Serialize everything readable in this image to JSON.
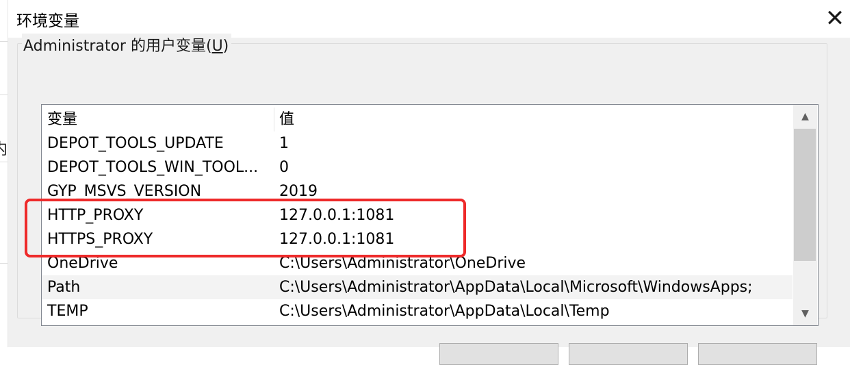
{
  "window": {
    "title": "环境变量",
    "close_glyph": "✕"
  },
  "background_window": {
    "cut_text": "内"
  },
  "user_vars": {
    "group_label_prefix": "Administrator 的用户变量(",
    "group_label_accel": "U",
    "group_label_suffix": ")",
    "columns": [
      "变量",
      "值"
    ],
    "rows": [
      {
        "name": "DEPOT_TOOLS_UPDATE",
        "value": "1"
      },
      {
        "name": "DEPOT_TOOLS_WIN_TOOL...",
        "value": "0"
      },
      {
        "name": "GYP_MSVS_VERSION",
        "value": "2019"
      },
      {
        "name": "HTTP_PROXY",
        "value": "127.0.0.1:1081"
      },
      {
        "name": "HTTPS_PROXY",
        "value": "127.0.0.1:1081"
      },
      {
        "name": "OneDrive",
        "value": "C:\\Users\\Administrator\\OneDrive"
      },
      {
        "name": "Path",
        "value": "C:\\Users\\Administrator\\AppData\\Local\\Microsoft\\WindowsApps;"
      },
      {
        "name": "TEMP",
        "value": "C:\\Users\\Administrator\\AppData\\Local\\Temp"
      }
    ],
    "selected_row": "Path",
    "scroll_up_glyph": "▲",
    "scroll_down_glyph": "▼"
  },
  "annotation": {
    "color": "#ee2a2a",
    "highlighted_rows": [
      "HTTP_PROXY",
      "HTTPS_PROXY"
    ]
  }
}
